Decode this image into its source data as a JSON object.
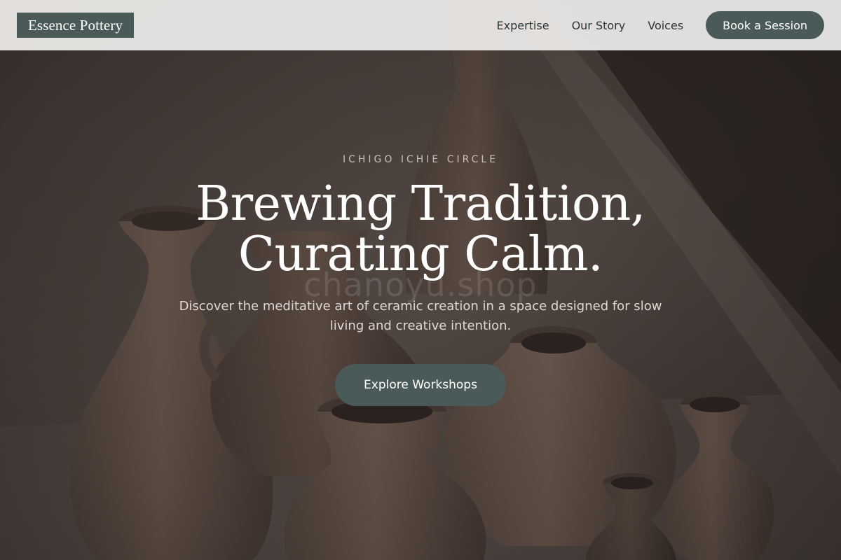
{
  "brand": {
    "name": "Essence Pottery",
    "accent_color": "#4a5a58"
  },
  "nav": {
    "links": [
      {
        "label": "Expertise"
      },
      {
        "label": "Our Story"
      },
      {
        "label": "Voices"
      }
    ],
    "cta_label": "Book a Session"
  },
  "hero": {
    "eyebrow": "ICHIGO ICHIE CIRCLE",
    "headline_line1": "Brewing Tradition,",
    "headline_line2": "Curating Calm.",
    "watermark": "chanoyu.shop",
    "subtitle": "Discover the meditative art of ceramic creation in a space designed for slow living and creative intention.",
    "cta_label": "Explore Workshops",
    "background_image": "clay-vases-photo"
  }
}
